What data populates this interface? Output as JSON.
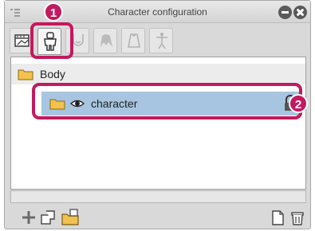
{
  "window": {
    "title": "Character configuration"
  },
  "tabs": [
    {
      "icon": "pose-tab-icon",
      "state": "normal"
    },
    {
      "icon": "body-figure-icon",
      "state": "active"
    },
    {
      "icon": "head-icon",
      "state": "disabled"
    },
    {
      "icon": "hair-icon",
      "state": "disabled"
    },
    {
      "icon": "clothing-icon",
      "state": "disabled"
    },
    {
      "icon": "skeleton-icon",
      "state": "disabled"
    }
  ],
  "tree": {
    "root_label": "Body",
    "selected_item": {
      "label": "character",
      "visible": true,
      "locked": true
    }
  },
  "callouts": {
    "one": "1",
    "two": "2"
  },
  "colors": {
    "highlight": "#c21a5e",
    "selection": "#a7c5e0",
    "folder": "#f2c14e"
  },
  "toolbar": {
    "left_buttons": [
      "add-icon",
      "new-folder-icon",
      "new-folder-from-selection-icon"
    ],
    "right_buttons": [
      "new-page-icon",
      "delete-icon"
    ]
  }
}
